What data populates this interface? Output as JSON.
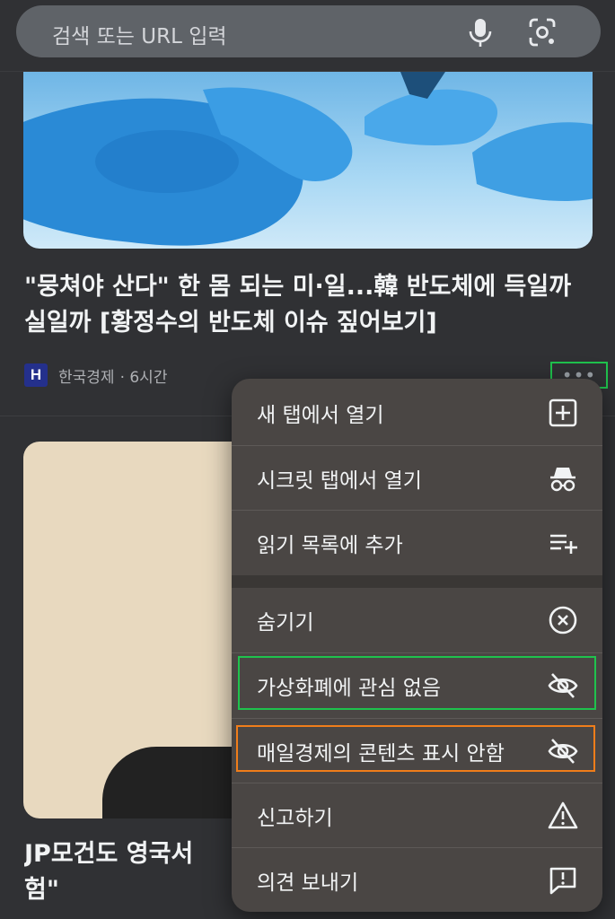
{
  "search": {
    "placeholder": "검색 또는 URL 입력",
    "mic_icon": "microphone-icon",
    "lens_icon": "camera-search-icon"
  },
  "feed": {
    "card1": {
      "headline": "\"뭉쳐야 산다\" 한 몸 되는 미·일...韓 반도체에 득일까 실일까 [황정수의 반도체 이슈 짚어보기]",
      "source_logo": "H",
      "source": "한국경제",
      "time": "· 6시간"
    },
    "card2": {
      "headline_line1": "JP모건도 영국서 ",
      "headline_line2": "험\""
    }
  },
  "menu": {
    "items": [
      {
        "label": "새 탭에서 열기",
        "icon": "new-tab-plus-icon"
      },
      {
        "label": "시크릿 탭에서 열기",
        "icon": "incognito-icon"
      },
      {
        "label": "읽기 목록에 추가",
        "icon": "reading-list-add-icon"
      },
      {
        "label": "숨기기",
        "icon": "close-circle-icon"
      },
      {
        "label": "가상화폐에 관심 없음",
        "icon": "eye-off-icon"
      },
      {
        "label": "매일경제의 콘텐츠 표시 안함",
        "icon": "eye-off-icon"
      },
      {
        "label": "신고하기",
        "icon": "warning-icon"
      },
      {
        "label": "의견 보내기",
        "icon": "feedback-icon"
      }
    ]
  },
  "colors": {
    "background": "#303134",
    "menu_background": "#4a4644",
    "highlight_green": "#1fc24d",
    "highlight_orange": "#f07d1a",
    "source_logo_bg": "#24308c"
  }
}
